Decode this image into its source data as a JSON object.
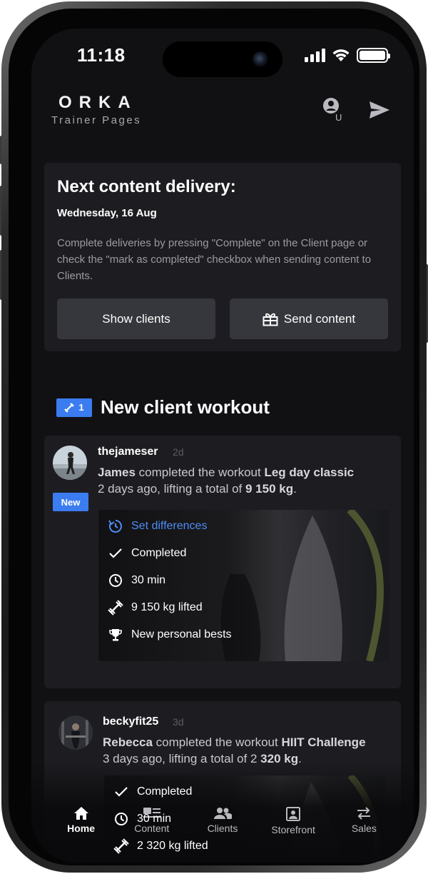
{
  "status_bar": {
    "time": "11:18"
  },
  "header": {
    "logo": "ORKA",
    "subtitle": "Trainer Pages",
    "profile_icon": "user-profile-icon",
    "send_icon": "paper-plane-icon"
  },
  "delivery": {
    "title": "Next content delivery:",
    "date": "Wednesday, 16 Aug",
    "description": "Complete deliveries by pressing \"Complete\" on the Client page or check the \"mark as completed\" checkbox when sending content to Clients.",
    "show_clients_label": "Show clients",
    "send_content_label": "Send content"
  },
  "section": {
    "badge_count": "1",
    "title": "New client workout"
  },
  "feed": [
    {
      "username": "thejameser",
      "ago": "2d",
      "name": "James",
      "verb": "completed the workout",
      "workout": "Leg day classic",
      "line2_prefix": "2 days ago, lifting a total of",
      "total": "9 150 kg",
      "badge": "New",
      "details": {
        "set_differences": "Set differences",
        "completed": "Completed",
        "duration": "30 min",
        "lifted": "9 150 kg lifted",
        "personal_bests": "New personal bests"
      }
    },
    {
      "username": "beckyfit25",
      "ago": "3d",
      "name": "Rebecca",
      "verb": "completed the workout",
      "workout": "HIIT Challenge",
      "line2_prefix": "3 days ago, lifting a total of 2",
      "total": "320 kg",
      "details": {
        "completed": "Completed",
        "duration": "30 min",
        "lifted": "2 320 kg lifted"
      }
    }
  ],
  "nav": {
    "home": "Home",
    "content": "Content",
    "clients": "Clients",
    "storefront": "Storefront",
    "sales": "Sales"
  },
  "colors": {
    "accent": "#3b7cf0",
    "background": "#111114",
    "card": "#1d1d21",
    "button": "#36363d"
  }
}
